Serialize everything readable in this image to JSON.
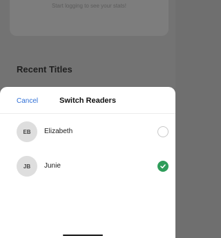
{
  "background": {
    "stats_hint": "Start logging to see your stats!",
    "section_title": "Recent Titles"
  },
  "sheet": {
    "cancel_label": "Cancel",
    "title": "Switch Readers",
    "readers": [
      {
        "initials": "EB",
        "name": "Elizabeth",
        "selected": false
      },
      {
        "initials": "JB",
        "name": "Junie",
        "selected": true
      }
    ]
  },
  "colors": {
    "accent": "#2f6fd6",
    "selected": "#2e9d5a",
    "overlay": "#737373"
  },
  "icons": {
    "selected": "checkmark-icon",
    "unselected": "radio-empty-icon"
  }
}
